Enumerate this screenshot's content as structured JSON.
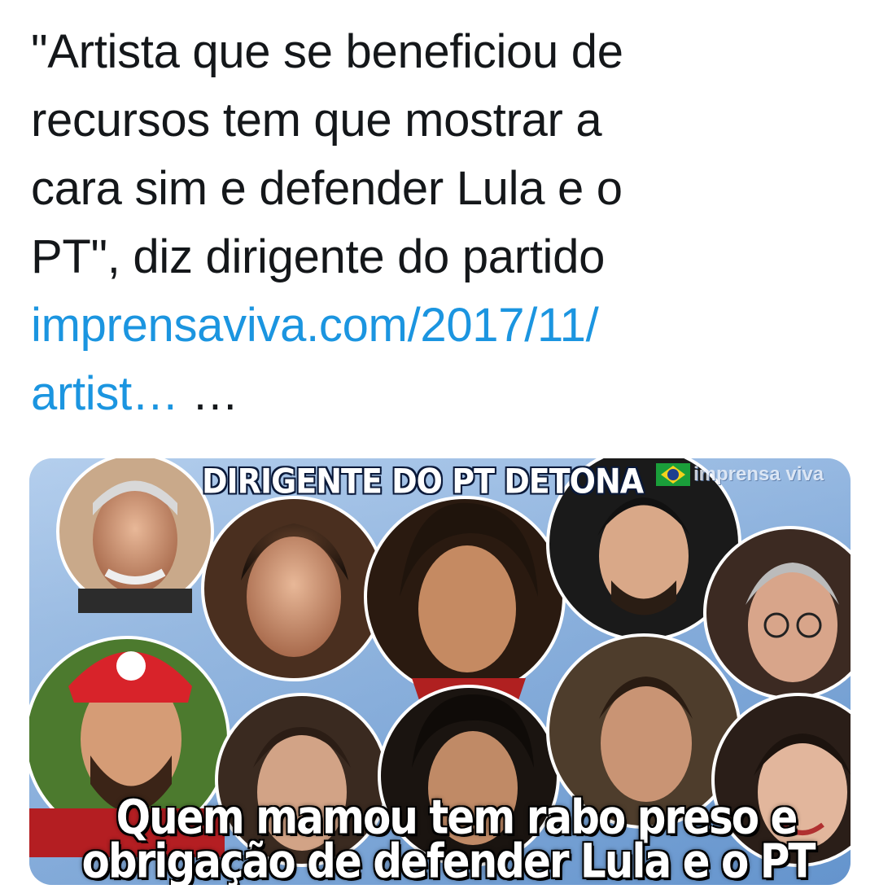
{
  "tweet": {
    "text_lines": [
      "\"Artista que se beneficiou de",
      "recursos tem que mostrar a",
      "cara sim e defender Lula e o",
      "PT\", diz dirigente do partido"
    ],
    "link_line_1": "imprensaviva.com/2017/11/",
    "link_line_2": "artist…",
    "trailing_ellipsis": " …",
    "link_color": "#1b95e0"
  },
  "media": {
    "headline": "DIRIGENTE DO PT DETONA",
    "brand": "imprensa viva",
    "caption_line_1": "Quem mamou tem rabo preso e",
    "caption_line_2": "obrigação de defender Lula e o PT",
    "flag_icon": "brazil-flag-icon",
    "portrait_icon": "person-portrait-icon"
  }
}
